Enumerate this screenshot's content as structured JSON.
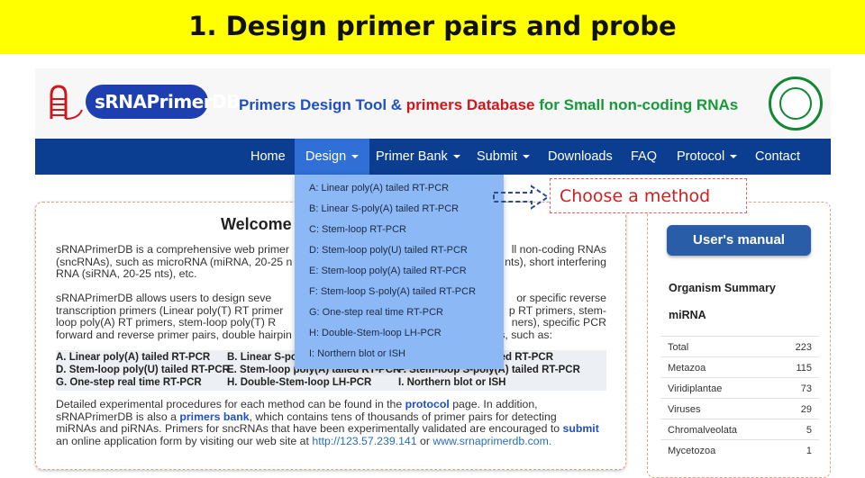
{
  "banner": {
    "title": "1. Design primer pairs and probe"
  },
  "header": {
    "logo_text": "sRNAPrimerDB",
    "tagline_part1": "Primers Design Tool &",
    "tagline_part2": "primers Database",
    "tagline_part3": "for Small non-coding RNAs",
    "emblem_icon": "university-emblem-icon"
  },
  "nav": {
    "items": [
      {
        "label": "Home"
      },
      {
        "label": "Design",
        "active": true,
        "dropdown": true
      },
      {
        "label": "Primer Bank",
        "dropdown": true
      },
      {
        "label": "Submit",
        "dropdown": true
      },
      {
        "label": "Downloads"
      },
      {
        "label": "FAQ"
      },
      {
        "label": "Protocol",
        "dropdown": true
      },
      {
        "label": "Contact"
      }
    ]
  },
  "design_menu": [
    "A: Linear poly(A) tailed RT-PCR",
    "B: Linear S-poly(A) tailed RT-PCR",
    "C: Stem-loop RT-PCR",
    "D: Stem-loop poly(U) tailed RT-PCR",
    "E: Stem-loop poly(A) tailed RT-PCR",
    "F: Stem-loop S-poly(A) tailed RT-PCR",
    "G: One-step real time RT-PCR",
    "H: Double-Stem-loop LH-PCR",
    "I: Northern blot or ISH"
  ],
  "welcome": {
    "title": "Welcome",
    "p1": [
      "sRNAPrimerDB is a comprehensive web primer",
      "ll non-coding RNAs",
      "(sncRNAs), such as microRNA (miRNA, 20-25 n",
      "nts), short interfering",
      "RNA (siRNA, 20-25 nts), etc."
    ],
    "p2": [
      "sRNAPrimerDB allows users to design seve",
      "or specific reverse",
      "transcription primers (Linear poly(T) RT primer",
      "p RT primers, stem-",
      "loop poly(A) RT primers, stem-loop poly(T) R",
      "ners), specific PCR",
      "forward and reverse primer pairs, double hairpin",
      "ods, such as:"
    ],
    "methods": [
      [
        "A. Linear poly(A) tailed RT-PCR",
        "B. Linear S-po",
        ""
      ],
      [
        "D. Stem-loop poly(U) tailed RT-PCR",
        "E. Stem-loop poly(A) tailed RT-PCR",
        "F. Stem-loop S-poly(A) tailed RT-PCR"
      ],
      [
        "G. One-step real time RT-PCR",
        "H. Double-Stem-loop LH-PCR",
        "I. Northern blot or ISH"
      ]
    ],
    "methods_row1_tail": "tailed RT-PCR",
    "p3_a": "Detailed experimental procedures for each method can be found in the",
    "p3_link1": "protocol",
    "p3_b": "page. In addition,",
    "p3_c": "sRNAPrimerDB is also a",
    "p3_link2": "primers bank",
    "p3_d": ", which contains tens of thousands of primer pairs for detecting",
    "p3_e": "miRNAs and piRNAs. Primers for sncRNAs that have been experimentally validated are encouraged to",
    "p3_link3": "submit",
    "p3_f": "an online application form by visiting our web site at",
    "p3_url1": "http://123.57.239.141",
    "p3_or": "or",
    "p3_url2": "www.srnaprimerdb.com."
  },
  "sidebar": {
    "manual_button": "User's manual",
    "organism_heading": "Organism Summary",
    "mirna_heading": "miRNA",
    "organisms": [
      {
        "name": "Total",
        "count": "223"
      },
      {
        "name": "Metazoa",
        "count": "115"
      },
      {
        "name": "Viridiplantae",
        "count": "73"
      },
      {
        "name": "Viruses",
        "count": "29"
      },
      {
        "name": "Chromalveolata",
        "count": "5"
      },
      {
        "name": "Mycetozoa",
        "count": "1"
      }
    ]
  },
  "callout": {
    "text": "Choose a method"
  }
}
